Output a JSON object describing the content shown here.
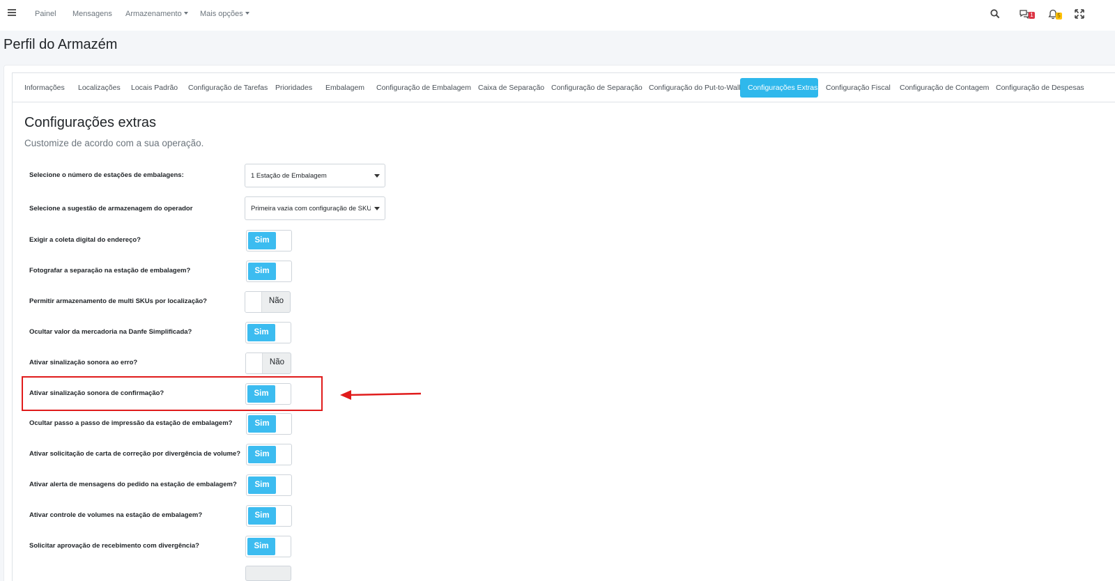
{
  "navbar": {
    "items": [
      {
        "label": "Painel",
        "dropdown": false
      },
      {
        "label": "Mensagens",
        "dropdown": false
      },
      {
        "label": "Armazenamento",
        "dropdown": true
      },
      {
        "label": "Mais opções",
        "dropdown": true
      }
    ],
    "messages_badge": "1",
    "notifications_badge": "5"
  },
  "page_title": "Perfil do Armazém",
  "tabs": [
    {
      "label": "Informações",
      "active": false
    },
    {
      "label": "Localizações",
      "active": false
    },
    {
      "label": "Locais Padrão",
      "active": false
    },
    {
      "label": "Configuração de Tarefas",
      "active": false
    },
    {
      "label": "Prioridades",
      "active": false
    },
    {
      "label": "Embalagem",
      "active": false
    },
    {
      "label": "Configuração de Embalagem",
      "active": false
    },
    {
      "label": "Caixa de Separação",
      "active": false
    },
    {
      "label": "Configuração de Separação",
      "active": false
    },
    {
      "label": "Configuração do Put-to-Wall",
      "active": false
    },
    {
      "label": "Configurações Extras",
      "active": true
    },
    {
      "label": "Configuração Fiscal",
      "active": false
    },
    {
      "label": "Configuração de Contagem",
      "active": false
    },
    {
      "label": "Configuração de Despesas",
      "active": false
    }
  ],
  "section": {
    "title": "Configurações extras",
    "subtitle": "Customize de acordo com a sua operação."
  },
  "selects": [
    {
      "label": "Selecione o número de estações de embalagens:",
      "value": "1 Estação de Embalagem"
    },
    {
      "label": "Selecione a sugestão de armazenagem do operador",
      "value": "Primeira vazia com configuração de SKU"
    }
  ],
  "toggles": [
    {
      "label": "Exigir a coleta digital do endereço?",
      "on": true
    },
    {
      "label": "Fotografar a separação na estação de embalagem?",
      "on": true
    },
    {
      "label": "Permitir armazenamento de multi SKUs por localização?",
      "on": false
    },
    {
      "label": "Ocultar valor da mercadoria na Danfe Simplificada?",
      "on": true
    },
    {
      "label": "Ativar sinalização sonora ao erro?",
      "on": false
    },
    {
      "label": "Ativar sinalização sonora de confirmação?",
      "on": true
    },
    {
      "label": "Ocultar passo a passo de impressão da estação de embalagem?",
      "on": true
    },
    {
      "label": "Ativar solicitação de carta de correção por divergência de volume?",
      "on": true
    },
    {
      "label": "Ativar alerta de mensagens do pedido na estação de embalagem?",
      "on": true
    },
    {
      "label": "Ativar controle de volumes na estação de embalagem?",
      "on": true
    },
    {
      "label": "Solicitar aprovação de recebimento com divergência?",
      "on": true
    }
  ],
  "toggle_text": {
    "on": "Sim",
    "off": "Não"
  },
  "colors": {
    "accent": "#2fb8ec",
    "toggle_on": "#3cbcf0",
    "highlight": "#e01b1b"
  }
}
